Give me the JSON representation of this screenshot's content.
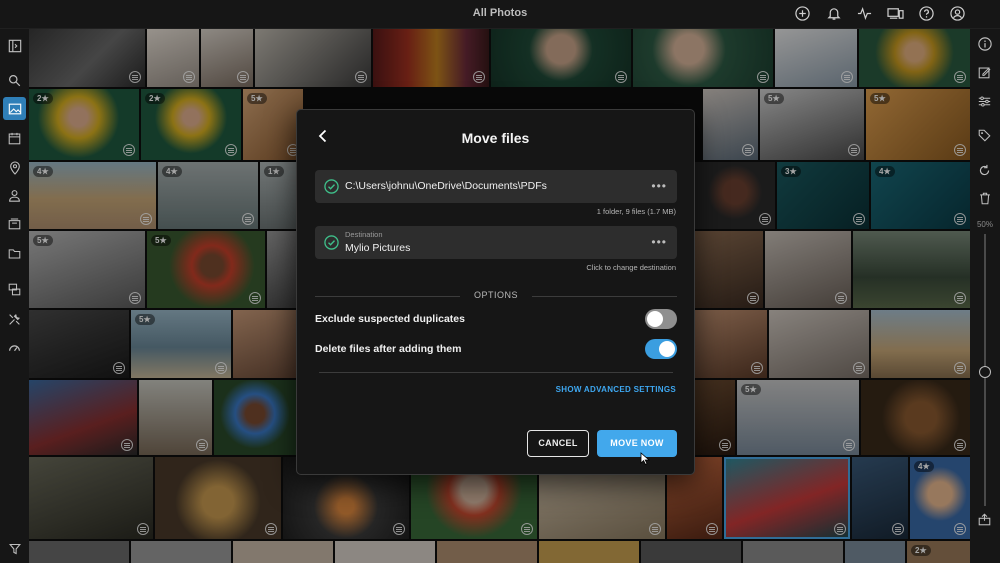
{
  "window": {
    "title": "All Photos"
  },
  "top_icons": [
    "add-icon",
    "bell-icon",
    "activity-icon",
    "devices-icon",
    "help-icon",
    "account-icon"
  ],
  "left_rail": [
    "sidebar-toggle-icon",
    "search-icon",
    "photos-icon",
    "calendar-icon",
    "map-pin-icon",
    "people-icon",
    "albums-icon",
    "folder-icon",
    "devices-icon",
    "tools-icon",
    "dashboard-icon",
    "filter-icon"
  ],
  "right_rail": {
    "icons": [
      "info-icon",
      "edit-icon",
      "adjust-icon",
      "tag-icon",
      "rotate-icon",
      "trash-icon",
      "export-icon"
    ],
    "zoom_label": "50%"
  },
  "grid": {
    "ratings": [
      "2★",
      "2★",
      "5★",
      "5★",
      "5★",
      "4★",
      "4★",
      "1★",
      "3★",
      "4★",
      "5★",
      "5★",
      "5★",
      "5★",
      "4★",
      "2★"
    ]
  },
  "dialog": {
    "title": "Move files",
    "source": {
      "path": "C:\\Users\\johnu\\OneDrive\\Documents\\PDFs",
      "summary": "1 folder, 9 files (1.7 MB)",
      "more": "•••"
    },
    "destination": {
      "label": "Destination",
      "value": "Mylio Pictures",
      "hint": "Click to change destination",
      "more": "•••"
    },
    "options_heading": "OPTIONS",
    "options": [
      {
        "label": "Exclude suspected duplicates",
        "enabled": false
      },
      {
        "label": "Delete files after adding them",
        "enabled": true
      }
    ],
    "advanced_link": "SHOW ADVANCED SETTINGS",
    "cancel_label": "CANCEL",
    "move_label": "MOVE NOW"
  },
  "colors": {
    "accent": "#42a8ec",
    "check": "#3fbf8a",
    "active_nav": "#2f7fb8"
  }
}
